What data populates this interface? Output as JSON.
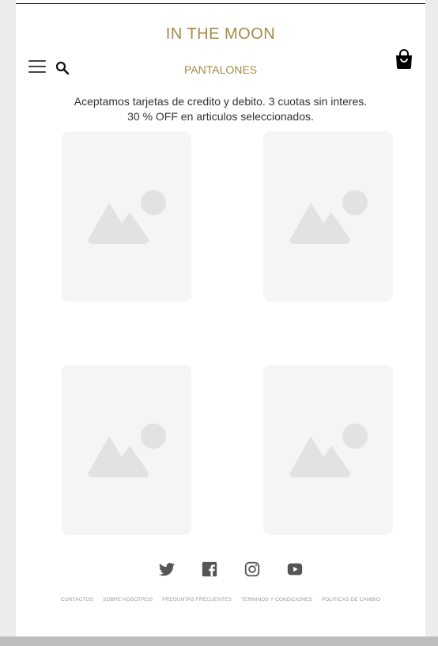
{
  "brand": {
    "name": "IN THE MOON",
    "color": "#a68a45"
  },
  "header": {
    "icons": [
      "menu-icon",
      "search-icon",
      "shopping-bag-icon"
    ],
    "category_title": "PANTALONES"
  },
  "promo": {
    "line1": "Aceptamos tarjetas de credito y debito. 3 cuotas sin interes.",
    "line2": "30 % OFF en articulos seleccionados."
  },
  "products": {
    "placeholder_icon": "image-placeholder-icon",
    "count": 4
  },
  "social": [
    "twitter-icon",
    "facebook-icon",
    "instagram-icon",
    "youtube-icon"
  ],
  "footer": {
    "links": [
      "CONTACTOS",
      "SOBRE NOSOTROS",
      "PREGUNTAS FRECUENTES",
      "TERMINOS Y CONDICIONES",
      "POLITICAS DE CAMBIO"
    ]
  }
}
